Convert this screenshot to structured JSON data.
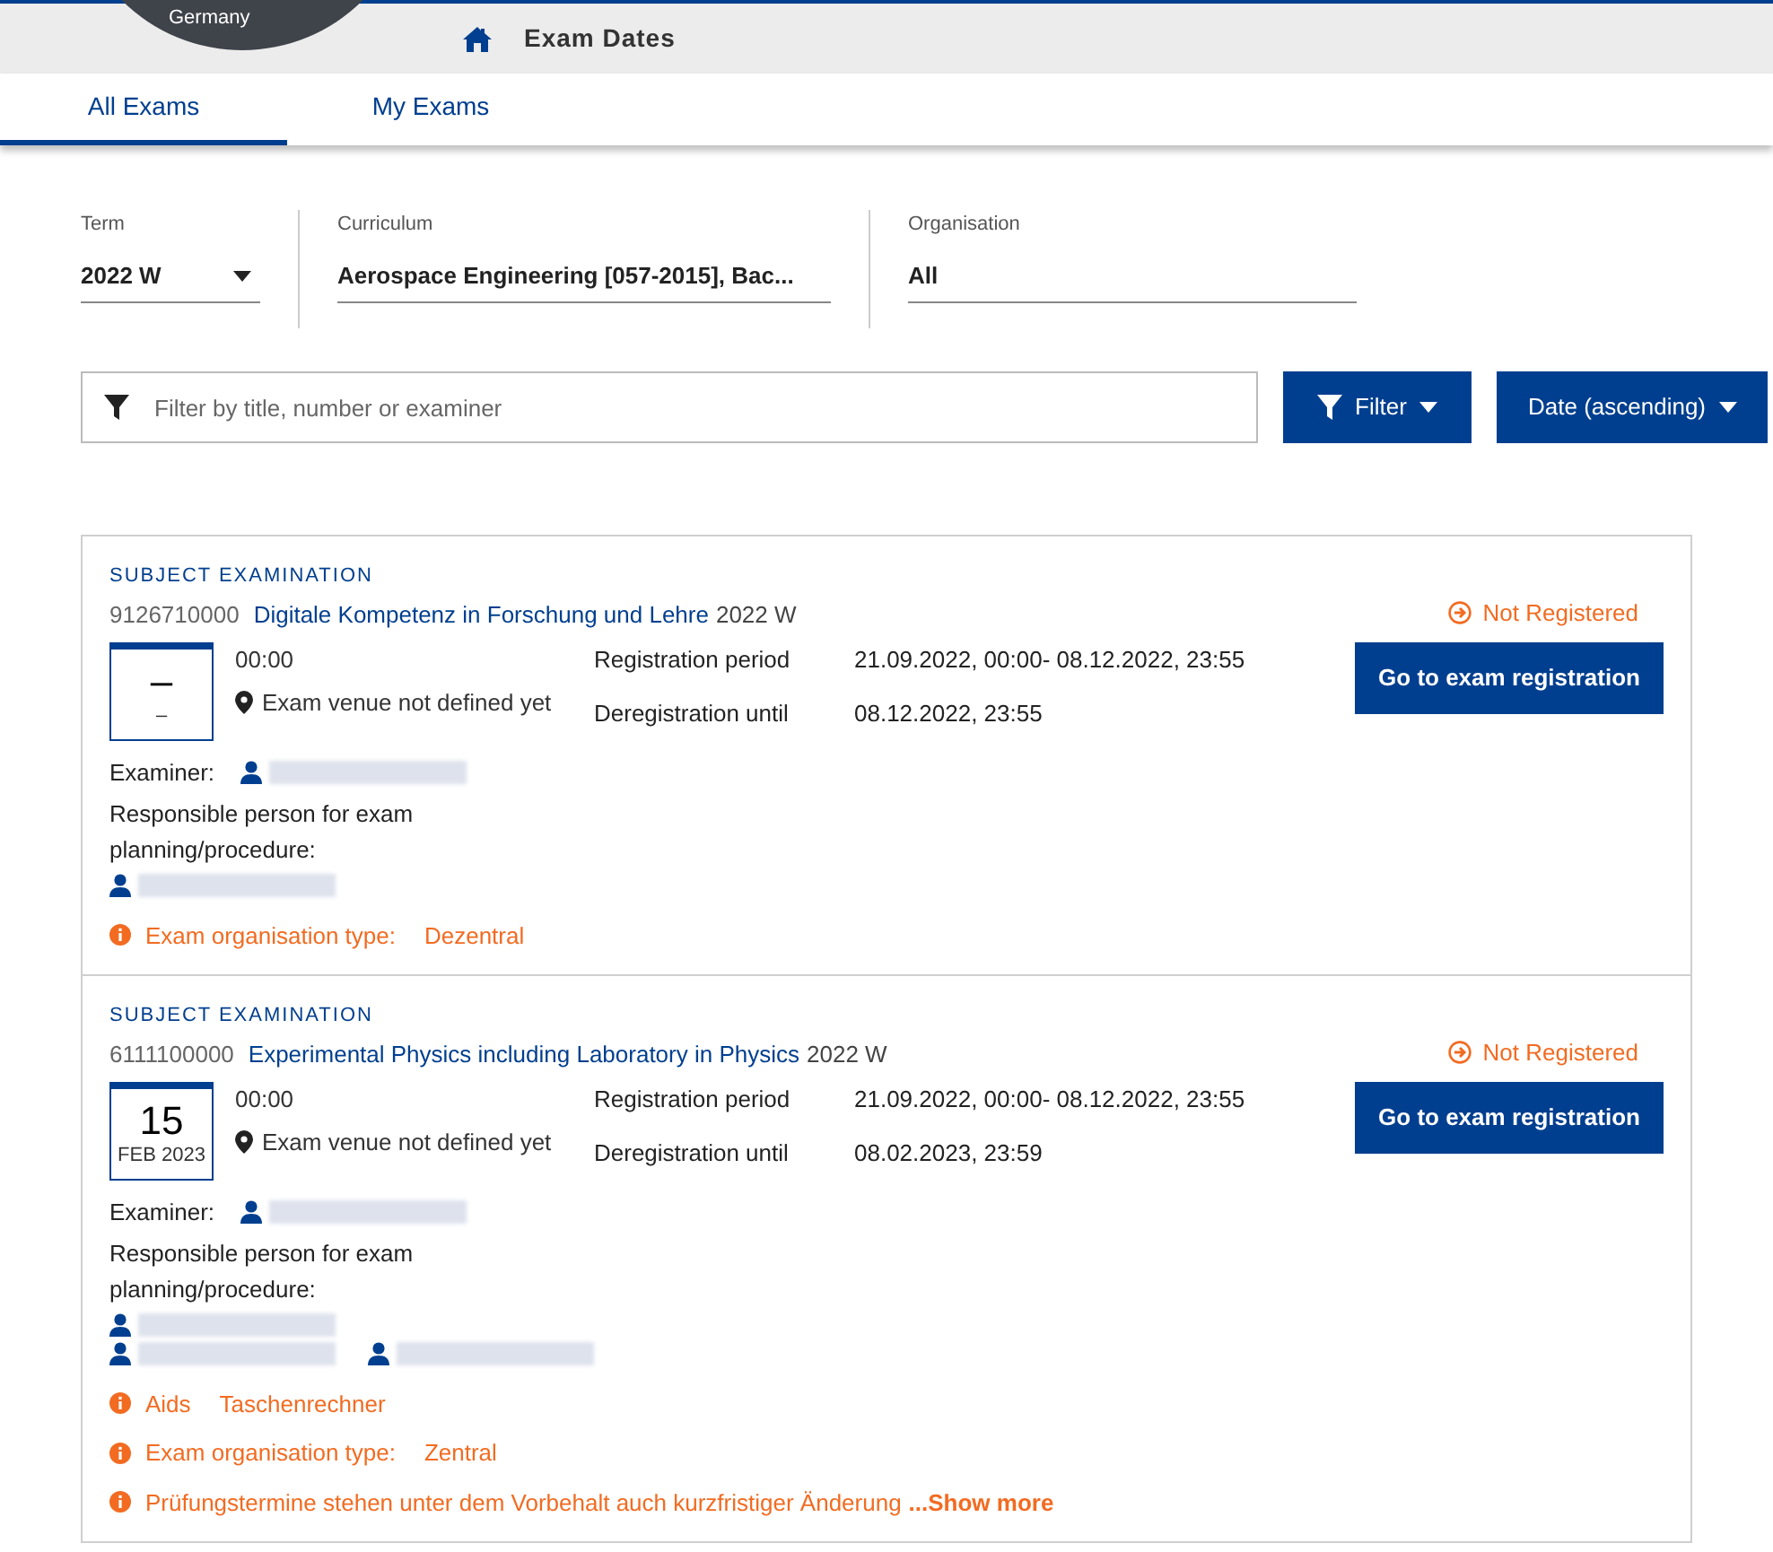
{
  "logo": {
    "text": "Germany"
  },
  "header": {
    "title": "Exam Dates"
  },
  "tabs": [
    {
      "label": "All Exams",
      "selected": true
    },
    {
      "label": "My Exams",
      "selected": false
    }
  ],
  "filters": [
    {
      "label": "Term",
      "value": "2022 W",
      "kind": "dropdown"
    },
    {
      "label": "Curriculum",
      "value": "Aerospace Engineering [057-2015], Bac...",
      "kind": "text"
    },
    {
      "label": "Organisation",
      "value": "All",
      "kind": "text"
    }
  ],
  "search": {
    "placeholder": "Filter by title, number or examiner"
  },
  "filter_button": "Filter",
  "sort_button": "Date (ascending)",
  "exams": [
    {
      "type": "SUBJECT EXAMINATION",
      "number": "9126710000",
      "title": "Digitale Kompetenz in Forschung und Lehre",
      "term": "2022 W",
      "day": "–",
      "month": "–",
      "time": "00:00",
      "venue": "Exam venue not defined yet",
      "registration_label": "Registration period",
      "registration_value": "21.09.2022, 00:00- 08.12.2022, 23:55",
      "deregistration_label": "Deregistration until",
      "deregistration_value": "08.12.2022, 23:55",
      "status": "Not Registered",
      "action": "Go to exam registration",
      "examiner_label": "Examiner:",
      "examiner": {
        "kind": "person"
      },
      "responsible_label": "Responsible person for exam planning/procedure:",
      "responsible_rows": [
        [
          {
            "kind": "person"
          }
        ]
      ],
      "notes": [
        {
          "kind": "pair",
          "label": "Exam organisation type:",
          "value": "Dezentral"
        }
      ]
    },
    {
      "type": "SUBJECT EXAMINATION",
      "number": "6111100000",
      "title": "Experimental Physics including Laboratory in Physics",
      "term": "2022 W",
      "day": "15",
      "month": "FEB 2023",
      "time": "00:00",
      "venue": "Exam venue not defined yet",
      "registration_label": "Registration period",
      "registration_value": "21.09.2022, 00:00- 08.12.2022, 23:55",
      "deregistration_label": "Deregistration until",
      "deregistration_value": "08.02.2023, 23:59",
      "status": "Not Registered",
      "action": "Go to exam registration",
      "examiner_label": "Examiner:",
      "examiner": {
        "kind": "person"
      },
      "responsible_label": "Responsible person for exam planning/procedure:",
      "responsible_rows": [
        [
          {
            "kind": "person"
          }
        ],
        [
          {
            "kind": "person"
          },
          {
            "kind": "person"
          }
        ]
      ],
      "notes": [
        {
          "kind": "pair",
          "label": "Aids",
          "value": "Taschenrechner"
        },
        {
          "kind": "pair",
          "label": "Exam organisation type:",
          "value": "Zentral"
        },
        {
          "kind": "more",
          "text": "Prüfungstermine stehen unter dem Vorbehalt auch kurzfristiger Änderung",
          "link": "...Show more"
        }
      ]
    }
  ]
}
